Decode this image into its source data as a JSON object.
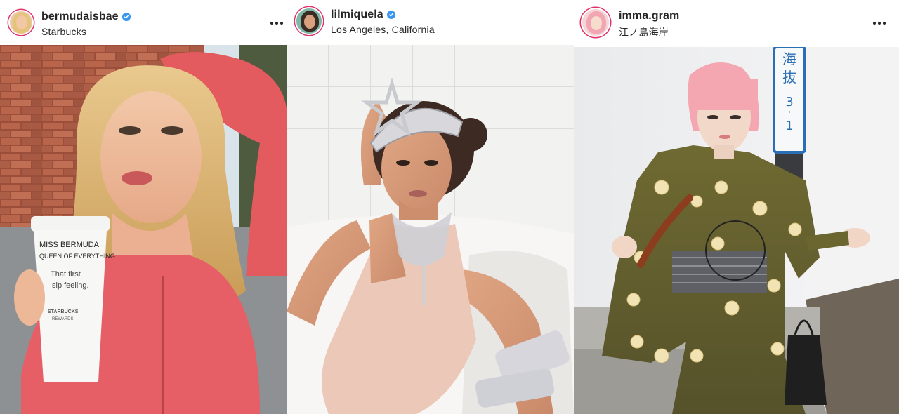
{
  "posts": [
    {
      "username": "bermudaisbae",
      "location": "Starbucks",
      "verified": true,
      "cup_text": [
        "MISS BERMUDA",
        "QUEEN OF EVERYTHING",
        "That first",
        "sip feeling.",
        "STARBUCKS",
        "REWARDS"
      ]
    },
    {
      "username": "lilmiquela",
      "location": "Los Angeles, California",
      "verified": true
    },
    {
      "username": "imma.gram",
      "location": "江ノ島海岸",
      "verified": false,
      "sign_text": [
        "海",
        "抜",
        "3",
        "·",
        "1"
      ]
    }
  ],
  "icons": {
    "verified": "verified-badge-icon",
    "more": "more-options-icon"
  },
  "colors": {
    "verified_blue": "#3897f0",
    "text": "#262626"
  }
}
